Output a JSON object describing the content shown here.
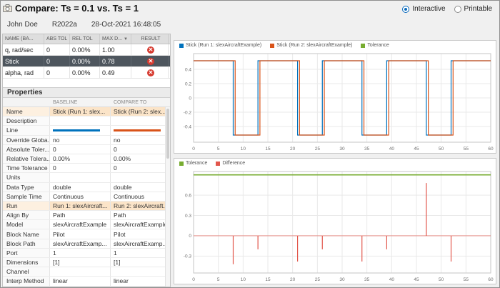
{
  "header": {
    "title": "Compare: Ts = 0.1 vs. Ts = 1",
    "user": "John Doe",
    "release": "R2022a",
    "timestamp": "28-Oct-2021 16:48:05",
    "view_options": [
      {
        "label": "Interactive",
        "selected": true
      },
      {
        "label": "Printable",
        "selected": false
      }
    ]
  },
  "results_table": {
    "columns": [
      "NAME (BA...",
      "ABS TOL",
      "REL TOL",
      "MAX D...",
      "RESULT"
    ],
    "sort_column": 3,
    "rows": [
      {
        "name": "q, rad/sec",
        "abs_tol": "0",
        "rel_tol": "0.00%",
        "max_diff": "1.00",
        "result": "fail",
        "selected": false
      },
      {
        "name": "Stick",
        "abs_tol": "0",
        "rel_tol": "0.00%",
        "max_diff": "0.78",
        "result": "fail",
        "selected": true
      },
      {
        "name": "alpha, rad",
        "abs_tol": "0",
        "rel_tol": "0.00%",
        "max_diff": "0.49",
        "result": "fail",
        "selected": false
      }
    ]
  },
  "properties": {
    "section_title": "Properties",
    "columns": [
      "",
      "BASELINE",
      "COMPARE TO"
    ],
    "rows": [
      {
        "label": "Name",
        "baseline": "Stick (Run 1: slex...",
        "compare": "Stick (Run 2: slex...",
        "highlight": true
      },
      {
        "label": "Description",
        "baseline": "",
        "compare": ""
      },
      {
        "label": "Line",
        "is_line": true,
        "baseline_color": "#0072BD",
        "compare_color": "#D95319"
      },
      {
        "label": "Override Globa...",
        "baseline": "no",
        "compare": "no"
      },
      {
        "label": "Absolute Toler...",
        "baseline": "0",
        "compare": "0"
      },
      {
        "label": "Relative Tolera...",
        "baseline": "0.00%",
        "compare": "0.00%"
      },
      {
        "label": "Time Tolerance",
        "baseline": "0",
        "compare": "0"
      },
      {
        "label": "Units",
        "baseline": "",
        "compare": ""
      },
      {
        "label": "Data Type",
        "baseline": "double",
        "compare": "double"
      },
      {
        "label": "Sample Time",
        "baseline": "Continuous",
        "compare": "Continuous"
      },
      {
        "label": "Run",
        "baseline": "Run 1: slexAircraft...",
        "compare": "Run 2: slexAircraft...",
        "highlight": true
      },
      {
        "label": "Align By",
        "baseline": "Path",
        "compare": "Path"
      },
      {
        "label": "Model",
        "baseline": "slexAircraftExample",
        "compare": "slexAircraftExample"
      },
      {
        "label": "Block Name",
        "baseline": "Pilot",
        "compare": "Pilot"
      },
      {
        "label": "Block Path",
        "baseline": "slexAircraftExamp...",
        "compare": "slexAircraftExamp..."
      },
      {
        "label": "Port",
        "baseline": "1",
        "compare": "1"
      },
      {
        "label": "Dimensions",
        "baseline": "[1]",
        "compare": "[1]"
      },
      {
        "label": "Channel",
        "baseline": "",
        "compare": ""
      },
      {
        "label": "Interp Method",
        "baseline": "linear",
        "compare": "linear"
      }
    ]
  },
  "colors": {
    "baseline_blue": "#0072BD",
    "compare_orange": "#D95319",
    "tolerance_green": "#77AC30",
    "difference_red": "#E2574C",
    "fail_red": "#D63A2F",
    "selected_row": "#4E565E",
    "highlight_orange": "#FBE4C8"
  },
  "chart_data": [
    {
      "id": "signal",
      "type": "line",
      "title": "",
      "legend": [
        {
          "label": "Stick (Run 1: slexAircraftExample)",
          "color": "#0072BD"
        },
        {
          "label": "Stick (Run 2: slexAircraftExample)",
          "color": "#D95319"
        },
        {
          "label": "Tolerance",
          "color": "#77AC30"
        }
      ],
      "xlim": [
        0,
        60
      ],
      "ylim": [
        -0.62,
        0.62
      ],
      "xticks": [
        0,
        5,
        10,
        15,
        20,
        25,
        30,
        35,
        40,
        45,
        50,
        55,
        60
      ],
      "yticks": [
        -0.4,
        -0.2,
        0,
        0.2,
        0.4
      ],
      "series": [
        {
          "name": "Stick (Run 1: slexAircraftExample)",
          "color": "#0072BD",
          "transitions": [
            0,
            8,
            13,
            21,
            26,
            34,
            39,
            47,
            52,
            60
          ],
          "levels": [
            0.52,
            -0.52,
            0.52,
            -0.52,
            0.52,
            -0.52,
            0.52,
            -0.52,
            0.52
          ]
        },
        {
          "name": "Stick (Run 2: slexAircraftExample)",
          "color": "#D95319",
          "transitions": [
            0,
            8.4,
            13.4,
            21.4,
            26.4,
            34.4,
            39.4,
            47.4,
            52.4,
            60
          ],
          "levels": [
            0.52,
            -0.52,
            0.52,
            -0.52,
            0.52,
            -0.52,
            0.52,
            -0.52,
            0.52
          ]
        }
      ]
    },
    {
      "id": "difference",
      "type": "line",
      "title": "",
      "legend": [
        {
          "label": "Tolerance",
          "color": "#77AC30"
        },
        {
          "label": "Difference",
          "color": "#E2574C"
        }
      ],
      "xlim": [
        0,
        60
      ],
      "ylim": [
        -0.55,
        0.95
      ],
      "xticks": [
        0,
        5,
        10,
        15,
        20,
        25,
        30,
        35,
        40,
        45,
        50,
        55,
        60
      ],
      "yticks": [
        -0.3,
        0,
        0.3,
        0.6
      ],
      "tolerance_y": 0.9,
      "tolerance_color": "#77AC30",
      "baseline": {
        "y": 0,
        "color": "#E2574C"
      },
      "spikes_color": "#E2574C",
      "spikes": [
        {
          "x": 8,
          "y": -0.42
        },
        {
          "x": 13,
          "y": -0.2
        },
        {
          "x": 21,
          "y": -0.38
        },
        {
          "x": 26,
          "y": -0.2
        },
        {
          "x": 34,
          "y": -0.38
        },
        {
          "x": 39,
          "y": -0.2
        },
        {
          "x": 47,
          "y": 0.78
        },
        {
          "x": 52,
          "y": -0.38
        }
      ]
    }
  ]
}
